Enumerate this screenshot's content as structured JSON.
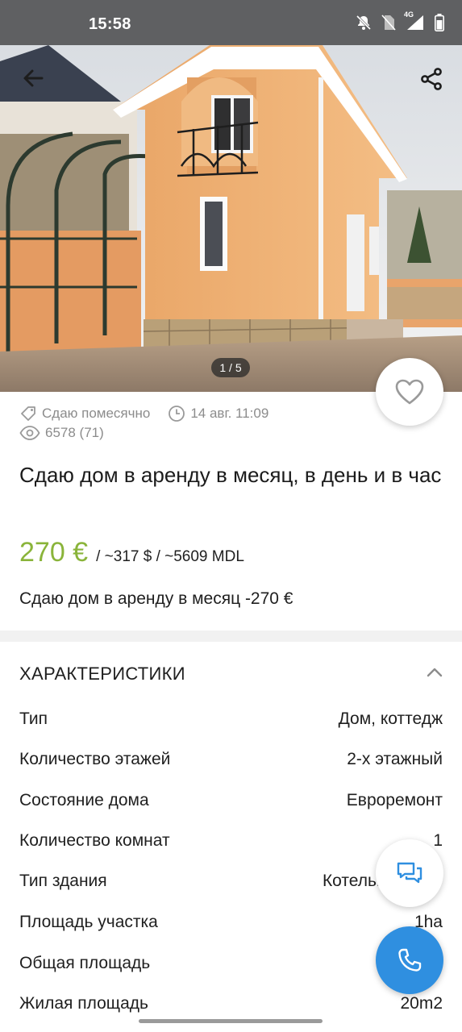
{
  "status_bar": {
    "time": "15:58",
    "network_label": "4G",
    "icons": [
      "bell-off-icon",
      "no-sim-icon",
      "signal-icon",
      "battery-icon"
    ]
  },
  "gallery": {
    "counter": "1 / 5",
    "icons": [
      "back-arrow-icon",
      "share-icon",
      "heart-icon"
    ]
  },
  "listing": {
    "rent_type": "Сдаю помесячно",
    "date": "14 авг. 11:09",
    "views": "6578 (71)",
    "title": "Сдаю дом   в аренду в месяц,  в день и в час",
    "price": "270 €",
    "price_converted": "/ ~317 $ / ~5609 MDL",
    "description": "Сдаю дом   в аренду в месяц -270 €"
  },
  "characteristics": {
    "title": "ХАРАКТЕРИСТИКИ",
    "rows": [
      {
        "label": "Тип",
        "value": "Дом, коттедж"
      },
      {
        "label": "Количество этажей",
        "value": "2-х этажный"
      },
      {
        "label": "Состояние дома",
        "value": "Евроремонт"
      },
      {
        "label": "Количество комнат",
        "value": "1"
      },
      {
        "label": "Тип здания",
        "value": "Котельц"
      },
      {
        "label": "Площадь участка",
        "value": "1ha"
      },
      {
        "label": "Общая площадь",
        "value": ""
      },
      {
        "label": "Жилая площадь",
        "value": "20m2"
      }
    ]
  },
  "colors": {
    "price": "#8ab43a",
    "call_button": "#2f8fe0",
    "chat_icon": "#2f8fe0",
    "status_bar": "#5f6062"
  }
}
